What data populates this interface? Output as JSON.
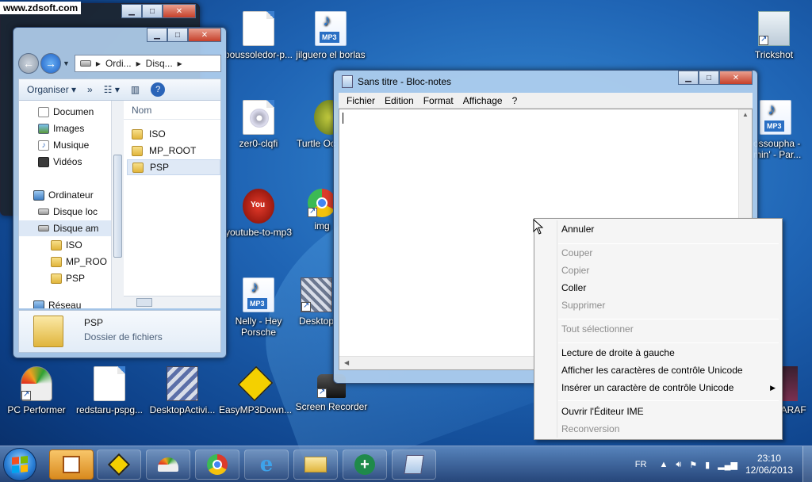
{
  "watermark": "www.zdsoft.com",
  "desktop_icons": {
    "bousoledor": "boussoledor-p...",
    "jilguero": "jilguero el borlas",
    "trickshot": "Trickshot",
    "zero": "zer0-clqfi",
    "turtle": "Turtle Oc",
    "rohff": "ossoupha - min' - Par...",
    "youtube": "youtube-to-mp3",
    "img": "img",
    "nelly": "Nelly - Hey Porsche",
    "desktop": "Desktop",
    "pcperformer": "PC Performer",
    "redstar": "redstaru-pspg...",
    "desktopactiv": "DesktopActivi...",
    "easymp3": "EasyMP3Down...",
    "screenrec": "Screen Recorder",
    "ilove": "I love CHARAF",
    "mp3_tag": "MP3"
  },
  "explorer": {
    "address": [
      "Ordi...",
      "Disq..."
    ],
    "toolbar": {
      "organize": "Organiser",
      "more": "»"
    },
    "tree": [
      "Documen",
      "Images",
      "Musique",
      "Vidéos",
      "Ordinateur",
      "Disque loc",
      "Disque am",
      "ISO",
      "MP_ROO",
      "PSP",
      "Réseau"
    ],
    "column": "Nom",
    "items": [
      "ISO",
      "MP_ROOT",
      "PSP"
    ],
    "details": {
      "name": "PSP",
      "type": "Dossier de fichiers"
    }
  },
  "notepad": {
    "title": "Sans titre - Bloc-notes",
    "menu": [
      "Fichier",
      "Edition",
      "Format",
      "Affichage",
      "?"
    ]
  },
  "context_menu": {
    "items": [
      {
        "label": "Annuler",
        "enabled": true
      },
      {
        "label": "Couper",
        "enabled": false
      },
      {
        "label": "Copier",
        "enabled": false
      },
      {
        "label": "Coller",
        "enabled": true
      },
      {
        "label": "Supprimer",
        "enabled": false
      },
      {
        "label": "Tout sélectionner",
        "enabled": false
      },
      {
        "label": "Lecture de droite à gauche",
        "enabled": true
      },
      {
        "label": "Afficher les caractères de contrôle Unicode",
        "enabled": true
      },
      {
        "label": "Insérer un caractère de contrôle Unicode",
        "enabled": true
      },
      {
        "label": "Ouvrir l'Éditeur IME",
        "enabled": true
      },
      {
        "label": "Reconversion",
        "enabled": false
      }
    ]
  },
  "taskbar": {
    "lang": "FR",
    "time": "23:10",
    "date": "12/06/2013"
  },
  "colors": {
    "accent": "#1f64b4",
    "disabled": "#8c8c8c"
  }
}
